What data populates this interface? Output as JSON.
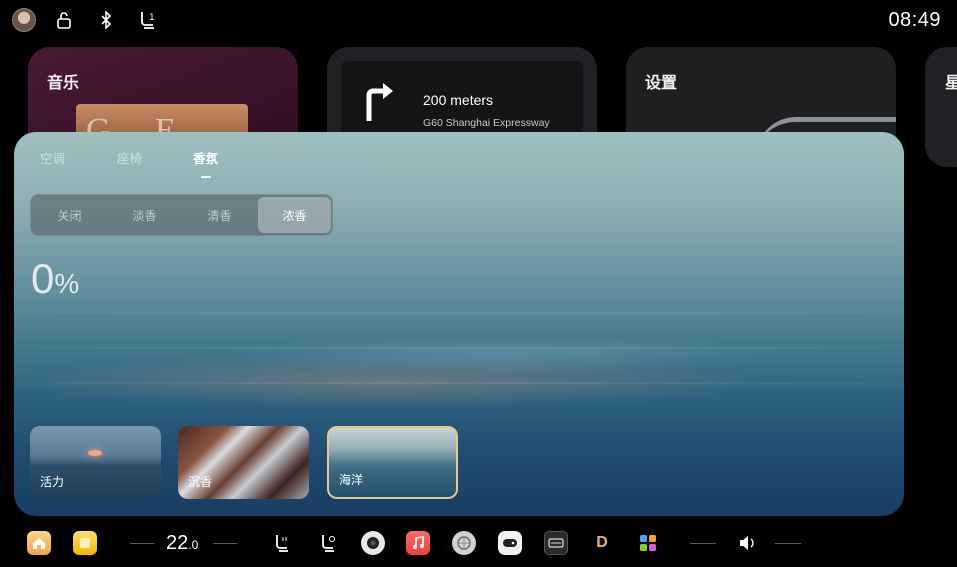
{
  "status": {
    "time": "08:49",
    "icons": [
      "avatar",
      "lock-open-icon",
      "bluetooth-icon",
      "seat-heat-icon"
    ]
  },
  "cards": {
    "music": {
      "title": "音乐",
      "art_letters": "G E M"
    },
    "navigation": {
      "distance": "200 meters",
      "road": "G60 Shanghai Expressway"
    },
    "settings": {
      "title": "设置"
    },
    "extra": {
      "title": "星"
    }
  },
  "panel": {
    "tabs": [
      {
        "label": "空调",
        "active": false
      },
      {
        "label": "座椅",
        "active": false
      },
      {
        "label": "香氛",
        "active": true
      }
    ],
    "intensity_options": [
      {
        "label": "关闭",
        "active": false
      },
      {
        "label": "淡香",
        "active": false
      },
      {
        "label": "清香",
        "active": false
      },
      {
        "label": "浓香",
        "active": true
      }
    ],
    "level_value": "0",
    "level_unit": "%",
    "scenes": [
      {
        "label": "活力",
        "selected": false
      },
      {
        "label": "沉香",
        "selected": false
      },
      {
        "label": "海洋",
        "selected": true
      }
    ]
  },
  "dock": {
    "temperature_int": "22",
    "temperature_dec": ".0",
    "apps": [
      "home-icon",
      "notes-icon",
      "seat-heat-icon",
      "seat-vent-icon",
      "camera-icon",
      "music-icon",
      "photo-icon",
      "game-icon",
      "video-icon",
      "d-app-icon",
      "apps-grid-icon"
    ],
    "volume_icon": "volume-icon"
  },
  "colors": {
    "selected_scene_border": "#e6c98a",
    "music_card": "#3a1229",
    "card_dark": "#1f2124"
  }
}
